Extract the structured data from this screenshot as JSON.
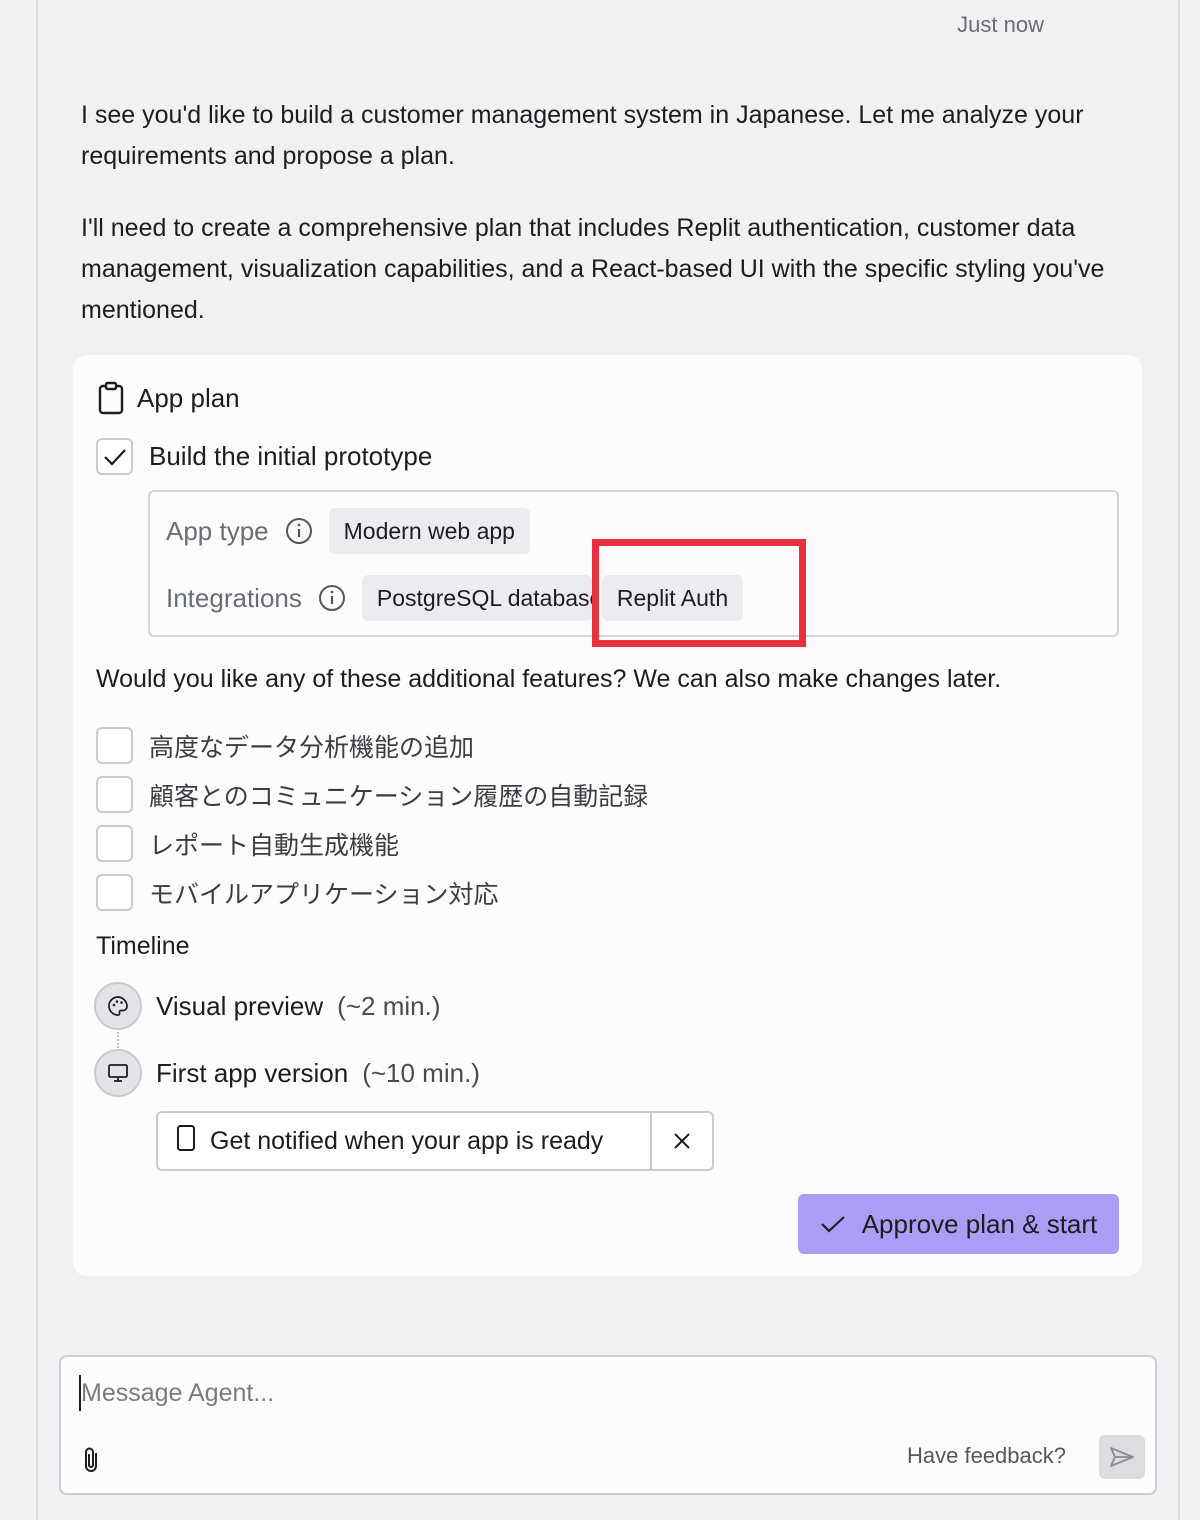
{
  "message": {
    "timestamp": "Just now",
    "paragraphs": [
      "I see you'd like to build a customer management system in Japanese. Let me analyze your requirements and propose a plan.",
      "I'll need to create a comprehensive plan that includes Replit authentication, customer data management, visualization capabilities, and a React-based UI with the specific styling you've mentioned."
    ]
  },
  "plan": {
    "title": "App plan",
    "prototype": {
      "label": "Build the initial prototype",
      "checked": true
    },
    "app_type": {
      "label": "App type",
      "value": "Modern web app"
    },
    "integrations": {
      "label": "Integrations",
      "items": [
        "PostgreSQL database",
        "Replit Auth"
      ]
    },
    "question": "Would you like any of these additional features? We can also make changes later.",
    "features": [
      {
        "label": "高度なデータ分析機能の追加",
        "checked": false
      },
      {
        "label": "顧客とのコミュニケーション履歴の自動記録",
        "checked": false
      },
      {
        "label": "レポート自動生成機能",
        "checked": false
      },
      {
        "label": "モバイルアプリケーション対応",
        "checked": false
      }
    ],
    "timeline": {
      "title": "Timeline",
      "steps": [
        {
          "label": "Visual preview",
          "duration": "(~2 min.)",
          "icon": "palette-icon"
        },
        {
          "label": "First app version",
          "duration": "(~10 min.)",
          "icon": "monitor-icon"
        }
      ]
    },
    "notify": {
      "label": "Get notified when your app is ready"
    },
    "approve_label": "Approve plan & start"
  },
  "composer": {
    "placeholder": "Message Agent...",
    "feedback": "Have feedback?"
  },
  "colors": {
    "accent": "#ab9ef7",
    "highlight": "#e8303f"
  }
}
